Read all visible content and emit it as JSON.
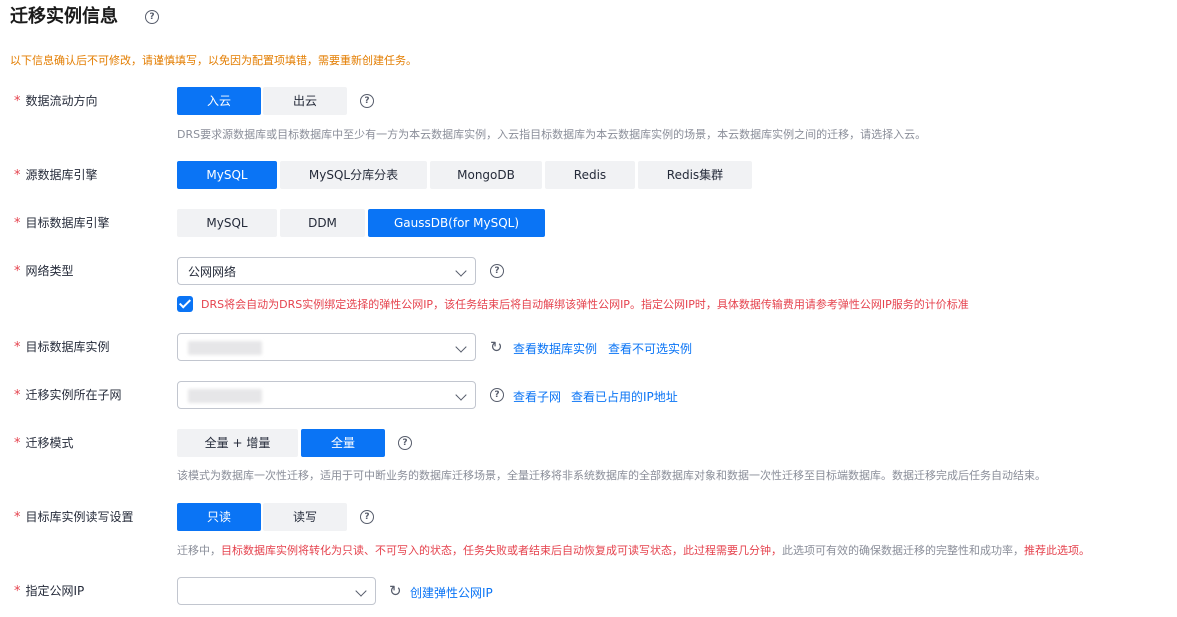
{
  "page": {
    "title": "迁移实例信息",
    "notice": "以下信息确认后不可修改，请谨慎填写，以免因为配置项填错，需要重新创建任务。"
  },
  "required_mark": "*",
  "fields": {
    "direction": {
      "label": "数据流动方向",
      "options": [
        "入云",
        "出云"
      ],
      "selected": "入云",
      "desc": "DRS要求源数据库或目标数据库中至少有一方为本云数据库实例，入云指目标数据库为本云数据库实例的场景，本云数据库实例之间的迁移，请选择入云。"
    },
    "source_engine": {
      "label": "源数据库引擎",
      "options": [
        "MySQL",
        "MySQL分库分表",
        "MongoDB",
        "Redis",
        "Redis集群"
      ],
      "selected": "MySQL"
    },
    "target_engine": {
      "label": "目标数据库引擎",
      "options": [
        "MySQL",
        "DDM",
        "GaussDB(for MySQL)"
      ],
      "selected": "GaussDB(for MySQL)"
    },
    "network": {
      "label": "网络类型",
      "value": "公网网络",
      "checkbox_checked": true,
      "checkbox_text": "DRS将会自动为DRS实例绑定选择的弹性公网IP，该任务结束后将自动解绑该弹性公网IP。指定公网IP时，具体数据传输费用请参考弹性公网IP服务的计价标准"
    },
    "target_instance": {
      "label": "目标数据库实例",
      "links": [
        "查看数据库实例",
        "查看不可选实例"
      ]
    },
    "subnet": {
      "label": "迁移实例所在子网",
      "links": [
        "查看子网",
        "查看已占用的IP地址"
      ]
    },
    "mode": {
      "label": "迁移模式",
      "options": [
        "全量 + 增量",
        "全量"
      ],
      "selected": "全量",
      "desc": "该模式为数据库一次性迁移，适用于可中断业务的数据库迁移场景，全量迁移将非系统数据库的全部数据库对象和数据一次性迁移至目标端数据库。数据迁移完成后任务自动结束。"
    },
    "rw_setting": {
      "label": "目标库实例读写设置",
      "options": [
        "只读",
        "读写"
      ],
      "selected": "只读",
      "desc_parts": [
        "迁移中，",
        "目标数据库实例将转化为只读、不可写入的状态，",
        "任务失败或者结束后自动恢复成可读写状态，此过程需要几分钟，",
        "此选项可有效的确保数据迁移的完整性和成功率，",
        "推荐此选项。"
      ]
    },
    "public_ip": {
      "label": "指定公网IP",
      "value": "",
      "link": "创建弹性公网IP"
    }
  },
  "icons": {
    "help": "?",
    "refresh": "↻"
  },
  "colors": {
    "primary": "#0a74f5",
    "required": "#e5424d",
    "warning": "#e37d00"
  }
}
